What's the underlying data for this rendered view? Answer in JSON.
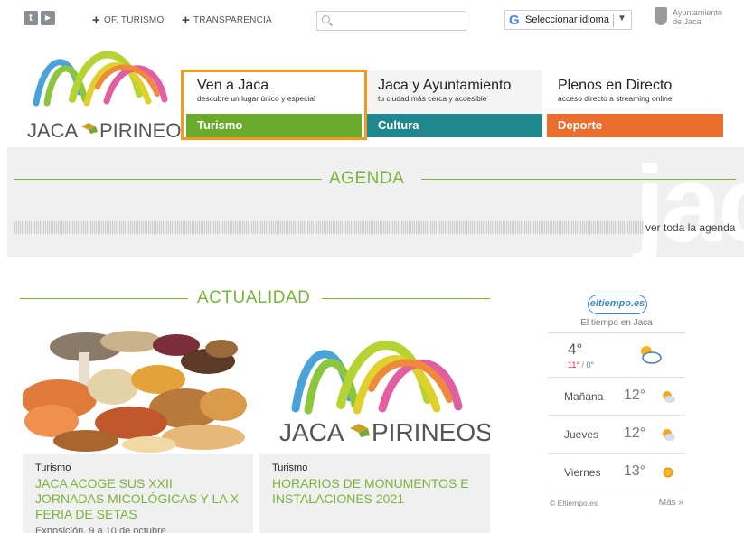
{
  "topbar": {
    "social": [
      {
        "icon": "twitter-icon",
        "glyph": "t"
      },
      {
        "icon": "youtube-icon",
        "glyph": "▶"
      }
    ],
    "links": [
      {
        "label": "OF. TURISMO",
        "icon": "plus-icon"
      },
      {
        "label": "TRANSPARENCIA",
        "icon": "plus-icon"
      }
    ],
    "search": {
      "placeholder": "",
      "value": ""
    },
    "language": {
      "label": "Seleccionar idioma",
      "logo": "G"
    },
    "ayuntamiento": {
      "line1": "Ayuntamiento",
      "line2": "de Jaca"
    }
  },
  "logo": {
    "text": "JACA PIRINEOS"
  },
  "menu": [
    {
      "title": "Ven a Jaca",
      "subtitle": "descubre un lugar único y especial",
      "bar": "Turismo",
      "color": "#6aaa2a"
    },
    {
      "title": "Jaca y Ayuntamiento",
      "subtitle": "tu ciudad más cerca y accesible",
      "bar": "Cultura",
      "color": "#22888f"
    },
    {
      "title": "Plenos en Directo",
      "subtitle": "acceso directo a streaming online",
      "bar": "Deporte",
      "color": "#ec6e2d"
    }
  ],
  "agenda": {
    "heading": "AGENDA",
    "more": "ver toda la agenda",
    "background_word": "jaca"
  },
  "actualidad": {
    "heading": "ACTUALIDAD",
    "cards": [
      {
        "category": "Turismo",
        "title": "JACA ACOGE SUS XXII JORNADAS MICOLÓGICAS Y LA X FERIA DE SETAS",
        "subtitle": "Exposición, 9 a 10 de octubre"
      },
      {
        "category": "Turismo",
        "title": "HORARIOS DE MONUMENTOS E INSTALACIONES 2021",
        "subtitle": ""
      }
    ]
  },
  "weather": {
    "brand": "eltiempo.es",
    "caption": "El tiempo en Jaca",
    "now": {
      "temp": "4°",
      "max": "11°",
      "min": "0°",
      "icon": "partly-cloudy-icon"
    },
    "forecast": [
      {
        "day": "Mañana",
        "temp": "12°",
        "icon": "sun-cloud-icon"
      },
      {
        "day": "Jueves",
        "temp": "12°",
        "icon": "sun-cloud-icon"
      },
      {
        "day": "Viernes",
        "temp": "13°",
        "icon": "sun-icon"
      }
    ],
    "credit": "© Eltiempo.es",
    "more": "Más »"
  },
  "colors": {
    "green": "#77b53a",
    "orange": "#f39a1f"
  }
}
